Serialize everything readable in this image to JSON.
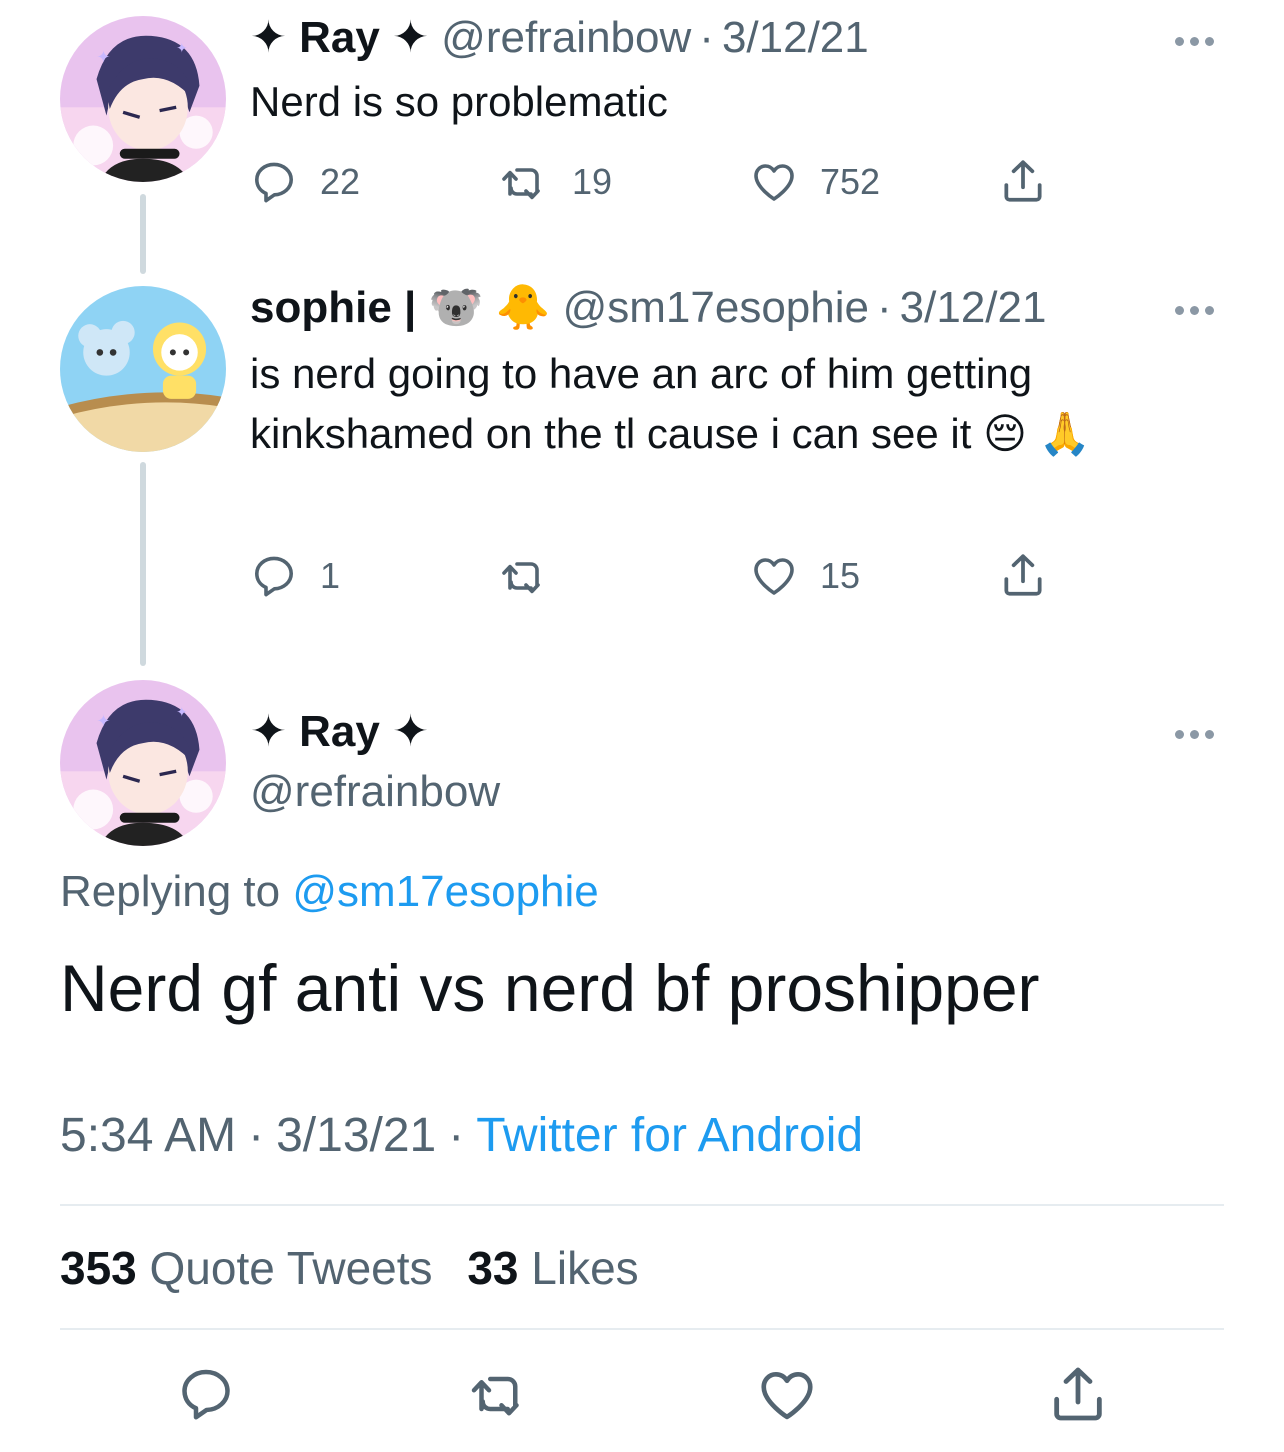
{
  "tweet1": {
    "star": "✦",
    "display_name": "Ray",
    "handle": "@refrainbow",
    "sep": "·",
    "date": "3/12/21",
    "text": "Nerd is so problematic",
    "reply_count": "22",
    "retweet_count": "19",
    "like_count": "752"
  },
  "tweet2": {
    "display_name": "sophie |",
    "name_emojis": "🐨 🐥",
    "handle": "@sm17esophie",
    "sep": "·",
    "date": "3/12/21",
    "text": "is nerd going to have an arc of him getting kinkshamed on the tl cause i can see it 😔 🙏",
    "reply_count": "1",
    "retweet_count": "",
    "like_count": "15"
  },
  "main_tweet": {
    "star": "✦",
    "display_name": "Ray",
    "handle": "@refrainbow",
    "replying_prefix": "Replying to",
    "replying_to": "@sm17esophie",
    "text": "Nerd gf anti vs nerd bf proshipper",
    "time": "5:34 AM",
    "sep": "·",
    "date": "3/13/21",
    "source": "Twitter for Android",
    "quote_count": "353",
    "quote_label": "Quote Tweets",
    "like_count": "33",
    "like_label": "Likes"
  },
  "icons": [
    "reply-icon",
    "retweet-icon",
    "like-icon",
    "share-icon",
    "more-icon"
  ],
  "colors": {
    "link": "#1d9bf0",
    "secondary": "#536471",
    "text": "#0f1419",
    "thread_line": "#cfd9de"
  }
}
